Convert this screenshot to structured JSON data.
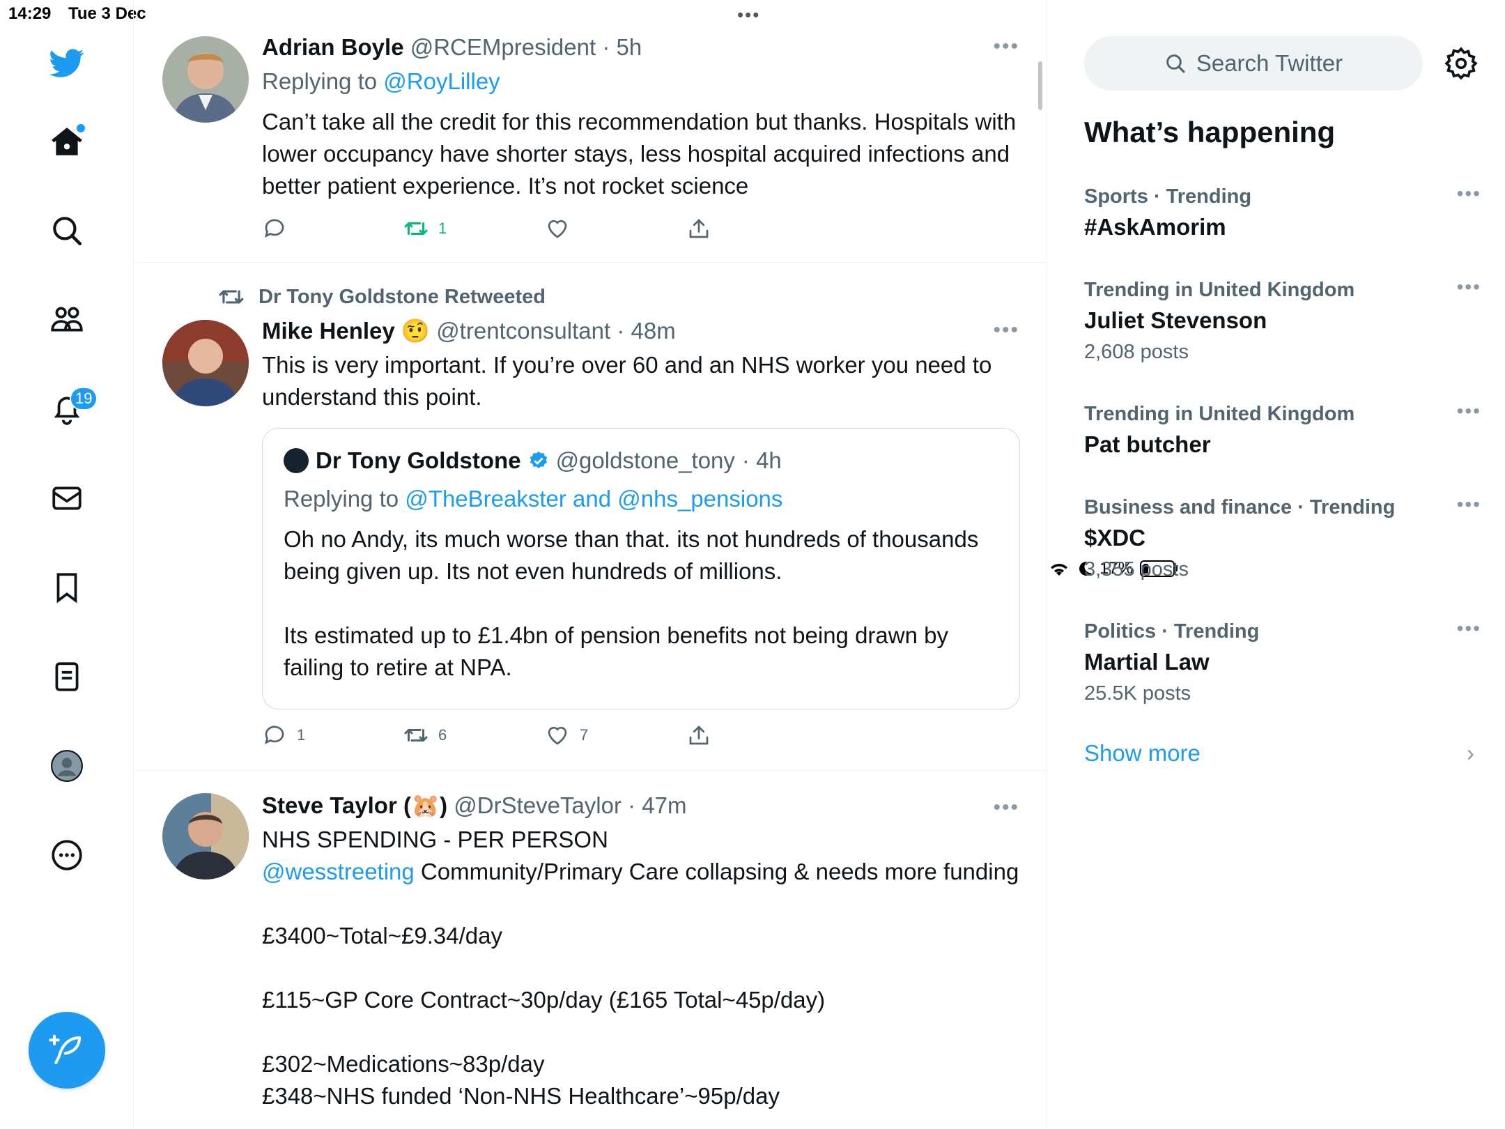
{
  "status_bar": {
    "time": "14:29",
    "date": "Tue 3 Dec",
    "battery": "17%",
    "battery_level": 0.17,
    "menu_dots": "•••"
  },
  "nav": {
    "notifications_count": "19"
  },
  "tweets": [
    {
      "name": "Adrian Boyle",
      "handle": "@RCEMpresident",
      "time": "· 5h",
      "reply_prefix": "Replying to",
      "reply_to": "@RoyLilley",
      "text": [
        "Can’t take all the credit for this recommendation but thanks. Hospitals with lower occupancy have shorter stays, less hospital acquired infections and better patient experience. It’s not rocket science"
      ],
      "reply_count": "",
      "retweet_count": "1",
      "like_count": ""
    },
    {
      "retweeted_by": "Dr Tony Goldstone Retweeted",
      "name": "Mike Henley",
      "emoji": "🤨",
      "handle": "@trentconsultant",
      "time": "· 48m",
      "text": [
        "This is very important. If you’re over 60 and an NHS worker you need to understand this point."
      ],
      "quote": {
        "name": "Dr Tony Goldstone",
        "handle": "@goldstone_tony",
        "time": "· 4h",
        "reply_prefix": "Replying to",
        "reply_to": "@TheBreakster and @nhs_pensions",
        "text": [
          "Oh no Andy, its much worse than that. its not hundreds of thousands being given up. Its not even hundreds of millions.",
          "",
          "Its estimated up to £1.4bn of pension benefits not being drawn by failing to retire at NPA."
        ]
      },
      "reply_count": "1",
      "retweet_count": "6",
      "like_count": "7"
    },
    {
      "name_prefix": "Steve Taylor (",
      "emoji": "🐹",
      "name_suffix": ")",
      "handle": "@DrSteveTaylor",
      "time": "· 47m",
      "line1": "NHS SPENDING - PER PERSON",
      "mention": "@wesstreeting",
      "line2": " Community/Primary Care collapsing & needs more funding",
      "text": [
        "",
        "£3400~Total~£9.34/day",
        "",
        "£115~GP Core Contract~30p/day (£165 Total~45p/day)",
        "",
        "£302~Medications~83p/day",
        "£348~NHS funded ‘Non-NHS Healthcare’~95p/day"
      ]
    }
  ],
  "sidebar": {
    "search_placeholder": "Search Twitter",
    "title": "What’s happening",
    "trends": [
      {
        "context": "Sports · Trending",
        "topic": "#AskAmorim",
        "count": ""
      },
      {
        "context": "Trending in United Kingdom",
        "topic": "Juliet Stevenson",
        "count": "2,608 posts"
      },
      {
        "context": "Trending in United Kingdom",
        "topic": "Pat butcher",
        "count": ""
      },
      {
        "context": "Business and finance · Trending",
        "topic": "$XDC",
        "count": "3,355 posts"
      },
      {
        "context": "Politics · Trending",
        "topic": "Martial Law",
        "count": "25.5K posts"
      }
    ],
    "show_more": "Show more"
  },
  "colors": {
    "accent": "#1d9bf0",
    "retweet_green": "#00ba7c",
    "secondary_text": "#536471"
  }
}
